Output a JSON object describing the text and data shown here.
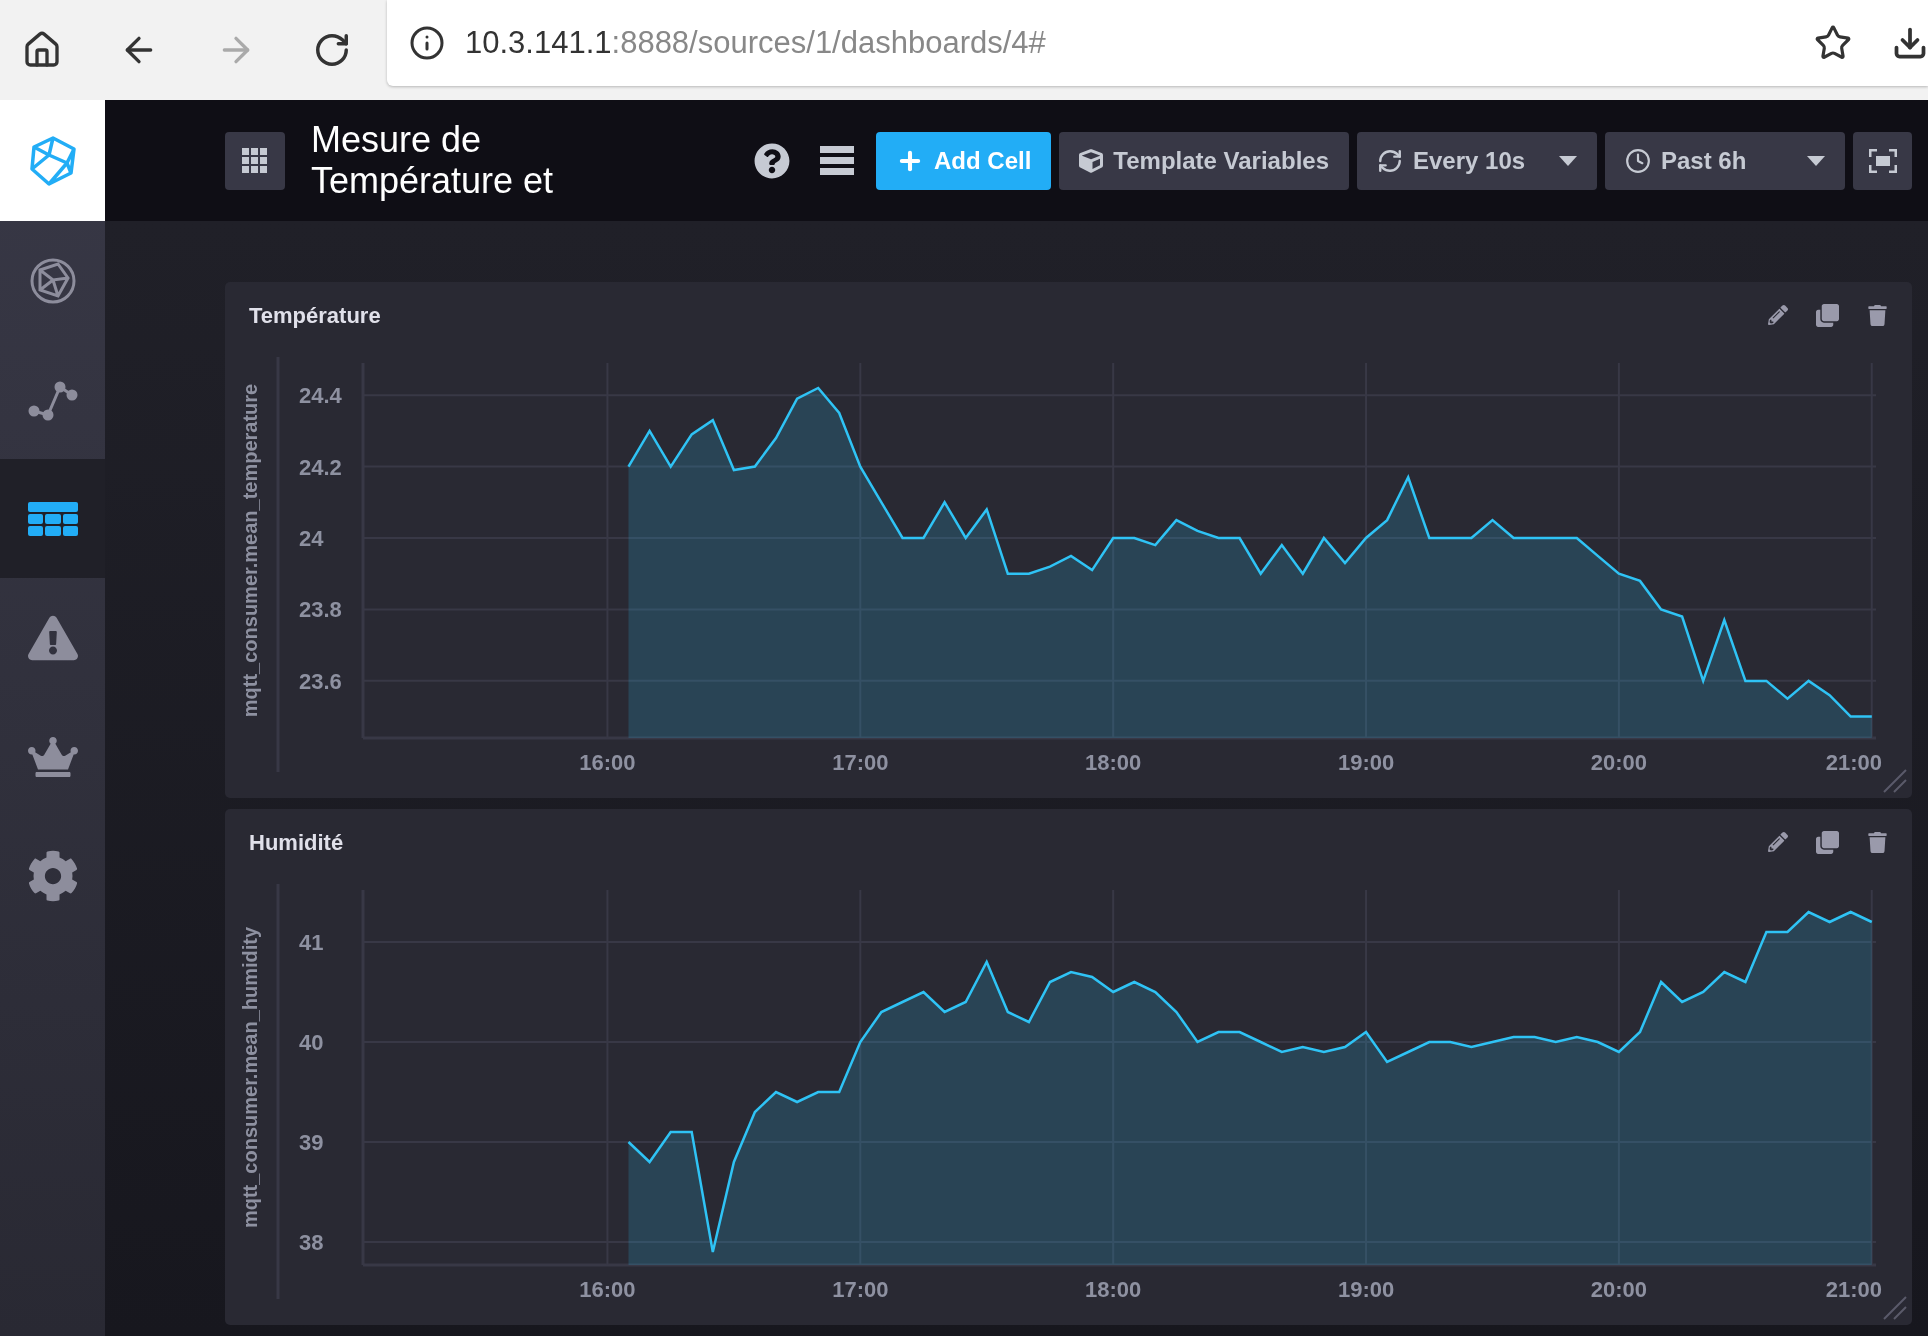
{
  "browser": {
    "url_host": "10.3.141.1",
    "url_path": ":8888/sources/1/dashboards/4#"
  },
  "sidebar": {
    "items": [
      {
        "kind": "hosts",
        "selected": false
      },
      {
        "kind": "data_explorer",
        "selected": false
      },
      {
        "kind": "dashboards",
        "selected": true
      },
      {
        "kind": "alerts",
        "selected": false
      },
      {
        "kind": "admin",
        "selected": false
      },
      {
        "kind": "config",
        "selected": false
      }
    ]
  },
  "header": {
    "title": "Mesure de Température et",
    "buttons": [
      {
        "kind": "add",
        "label": "Add Cell"
      },
      {
        "kind": "template",
        "label": "Template Variables"
      },
      {
        "kind": "refresh",
        "label": "Every 10s"
      },
      {
        "kind": "range",
        "label": "Past 6h"
      }
    ]
  },
  "cells": [
    {
      "title": "Température",
      "chart_data": {
        "type": "area",
        "grid": true,
        "ylabel": "mqtt_consumer.mean_temperature",
        "x": [
          965,
          970,
          975,
          980,
          985,
          990,
          995,
          1000,
          1005,
          1010,
          1015,
          1020,
          1025,
          1030,
          1035,
          1040,
          1045,
          1050,
          1055,
          1060,
          1065,
          1070,
          1075,
          1080,
          1085,
          1090,
          1095,
          1100,
          1105,
          1110,
          1115,
          1120,
          1125,
          1130,
          1135,
          1140,
          1145,
          1150,
          1155,
          1160,
          1165,
          1170,
          1175,
          1180,
          1185,
          1190,
          1195,
          1200,
          1205,
          1210,
          1215,
          1220,
          1225,
          1230,
          1235,
          1240,
          1245,
          1250,
          1255,
          1260
        ],
        "series": [
          {
            "color": "#2fc3f5",
            "values": [
              24.2,
              24.3,
              24.2,
              24.29,
              24.33,
              24.19,
              24.2,
              24.28,
              24.39,
              24.42,
              24.35,
              24.2,
              24.1,
              24.0,
              24.0,
              24.1,
              24.0,
              24.08,
              23.9,
              23.9,
              23.92,
              23.95,
              23.91,
              24.0,
              24.0,
              23.98,
              24.05,
              24.02,
              24.0,
              24.0,
              23.9,
              23.98,
              23.9,
              24.0,
              23.93,
              24.0,
              24.05,
              24.17,
              24.0,
              24.0,
              24.0,
              24.05,
              24.0,
              24.0,
              24.0,
              24.0,
              23.95,
              23.9,
              23.88,
              23.8,
              23.78,
              23.6,
              23.77,
              23.6,
              23.6,
              23.55,
              23.6,
              23.56,
              23.5,
              23.5
            ]
          }
        ],
        "xlim": [
          902,
          1261
        ],
        "ylim": [
          23.44,
          24.49
        ],
        "xticks": [
          {
            "value": 960,
            "label": "16:00"
          },
          {
            "value": 1020,
            "label": "17:00"
          },
          {
            "value": 1080,
            "label": "18:00"
          },
          {
            "value": 1140,
            "label": "19:00"
          },
          {
            "value": 1200,
            "label": "20:00"
          },
          {
            "value": 1260,
            "label": "21:00"
          }
        ],
        "yticks": [
          {
            "value": 23.6,
            "label": "23.6"
          },
          {
            "value": 23.8,
            "label": "23.8"
          },
          {
            "value": 24,
            "label": "24"
          },
          {
            "value": 24.2,
            "label": "24.2"
          },
          {
            "value": 24.4,
            "label": "24.4"
          }
        ]
      }
    },
    {
      "title": "Humidité",
      "chart_data": {
        "type": "area",
        "grid": true,
        "ylabel": "mqtt_consumer.mean_humidity",
        "x": [
          965,
          970,
          975,
          980,
          985,
          990,
          995,
          1000,
          1005,
          1010,
          1015,
          1020,
          1025,
          1030,
          1035,
          1040,
          1045,
          1050,
          1055,
          1060,
          1065,
          1070,
          1075,
          1080,
          1085,
          1090,
          1095,
          1100,
          1105,
          1110,
          1115,
          1120,
          1125,
          1130,
          1135,
          1140,
          1145,
          1150,
          1155,
          1160,
          1165,
          1170,
          1175,
          1180,
          1185,
          1190,
          1195,
          1200,
          1205,
          1210,
          1215,
          1220,
          1225,
          1230,
          1235,
          1240,
          1245,
          1250,
          1255,
          1260
        ],
        "series": [
          {
            "color": "#2fc3f5",
            "values": [
              39.0,
              38.8,
              39.1,
              39.1,
              37.9,
              38.8,
              39.3,
              39.5,
              39.4,
              39.5,
              39.5,
              40.0,
              40.3,
              40.4,
              40.5,
              40.3,
              40.4,
              40.8,
              40.3,
              40.2,
              40.6,
              40.7,
              40.65,
              40.5,
              40.6,
              40.5,
              40.3,
              40.0,
              40.1,
              40.1,
              40.0,
              39.9,
              39.95,
              39.9,
              39.95,
              40.1,
              39.8,
              39.9,
              40.0,
              40.0,
              39.95,
              40.0,
              40.05,
              40.05,
              40.0,
              40.05,
              40.0,
              39.9,
              40.1,
              40.6,
              40.4,
              40.5,
              40.7,
              40.6,
              41.1,
              41.1,
              41.3,
              41.2,
              41.3,
              41.2
            ]
          }
        ],
        "xlim": [
          902,
          1261
        ],
        "ylim": [
          37.77,
          41.52
        ],
        "xticks": [
          {
            "value": 960,
            "label": "16:00"
          },
          {
            "value": 1020,
            "label": "17:00"
          },
          {
            "value": 1080,
            "label": "18:00"
          },
          {
            "value": 1140,
            "label": "19:00"
          },
          {
            "value": 1200,
            "label": "20:00"
          },
          {
            "value": 1260,
            "label": "21:00"
          }
        ],
        "yticks": [
          {
            "value": 38,
            "label": "38"
          },
          {
            "value": 39,
            "label": "39"
          },
          {
            "value": 40,
            "label": "40"
          },
          {
            "value": 41,
            "label": "41"
          }
        ]
      }
    }
  ]
}
